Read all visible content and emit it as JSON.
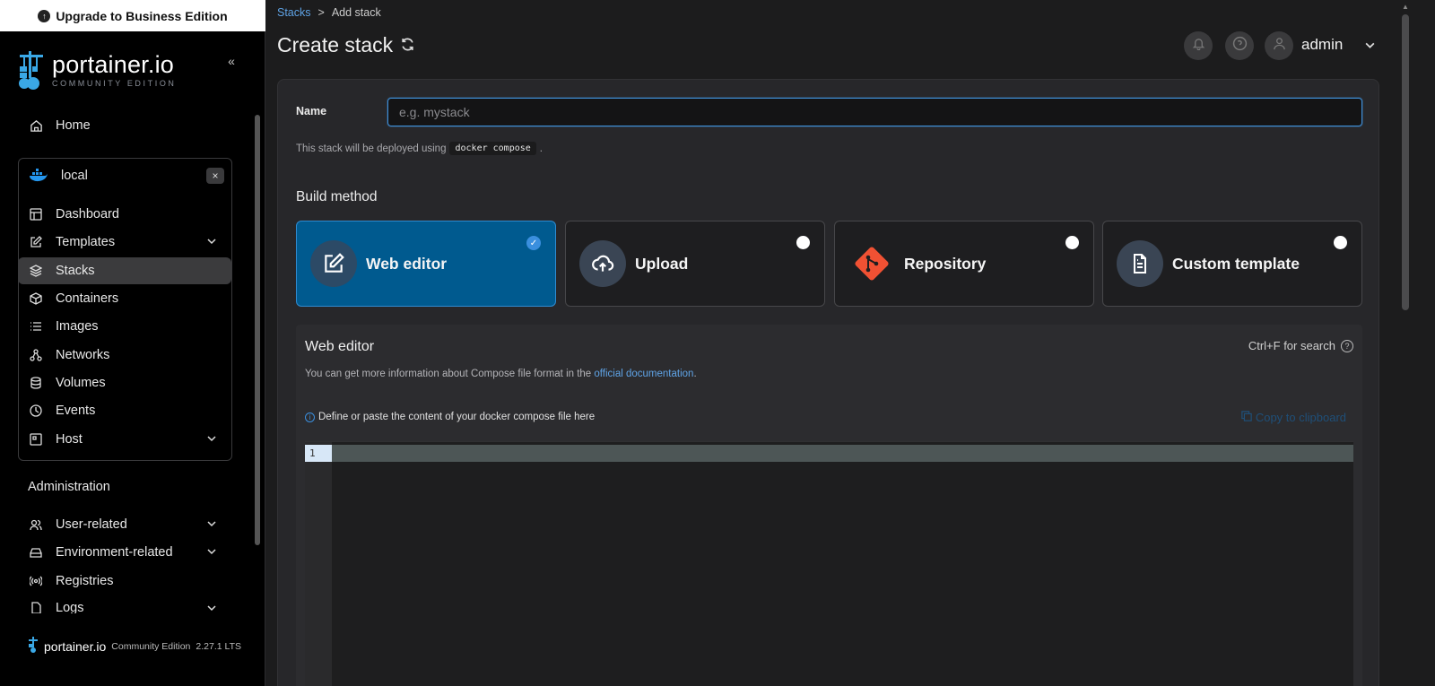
{
  "upgrade": {
    "label": "Upgrade to Business Edition"
  },
  "logo": {
    "main": "portainer.io",
    "sub": "COMMUNITY EDITION"
  },
  "nav": {
    "home": "Home",
    "env_name": "local",
    "items": [
      {
        "label": "Dashboard"
      },
      {
        "label": "Templates"
      },
      {
        "label": "Stacks"
      },
      {
        "label": "Containers"
      },
      {
        "label": "Images"
      },
      {
        "label": "Networks"
      },
      {
        "label": "Volumes"
      },
      {
        "label": "Events"
      },
      {
        "label": "Host"
      }
    ],
    "admin_title": "Administration",
    "admin_items": [
      {
        "label": "User-related"
      },
      {
        "label": "Environment-related"
      },
      {
        "label": "Registries"
      },
      {
        "label": "Logs"
      }
    ]
  },
  "footer": {
    "brand": "portainer.io",
    "edition": "Community Edition",
    "version": "2.27.1 LTS"
  },
  "breadcrumb": {
    "parent": "Stacks",
    "sep": ">",
    "current": "Add stack"
  },
  "page": {
    "title": "Create stack"
  },
  "user": {
    "name": "admin"
  },
  "form": {
    "name_label": "Name",
    "name_placeholder": "e.g. mystack",
    "deploy_prefix": "This stack will be deployed using",
    "deploy_code": "docker compose",
    "deploy_suffix": ".",
    "build_title": "Build method",
    "methods": [
      {
        "label": "Web editor"
      },
      {
        "label": "Upload"
      },
      {
        "label": "Repository"
      },
      {
        "label": "Custom template"
      }
    ]
  },
  "editor": {
    "title": "Web editor",
    "search_hint": "Ctrl+F for search",
    "info_prefix": "You can get more information about Compose file format in the",
    "info_link": "official documentation",
    "info_suffix": ".",
    "define_text": "Define or paste the content of your docker compose file here",
    "copy_label": "Copy to clipboard",
    "line_number": "1"
  },
  "colors": {
    "accent": "#3a8fde",
    "selected_bg": "#005a8f",
    "git": "#f05133"
  }
}
